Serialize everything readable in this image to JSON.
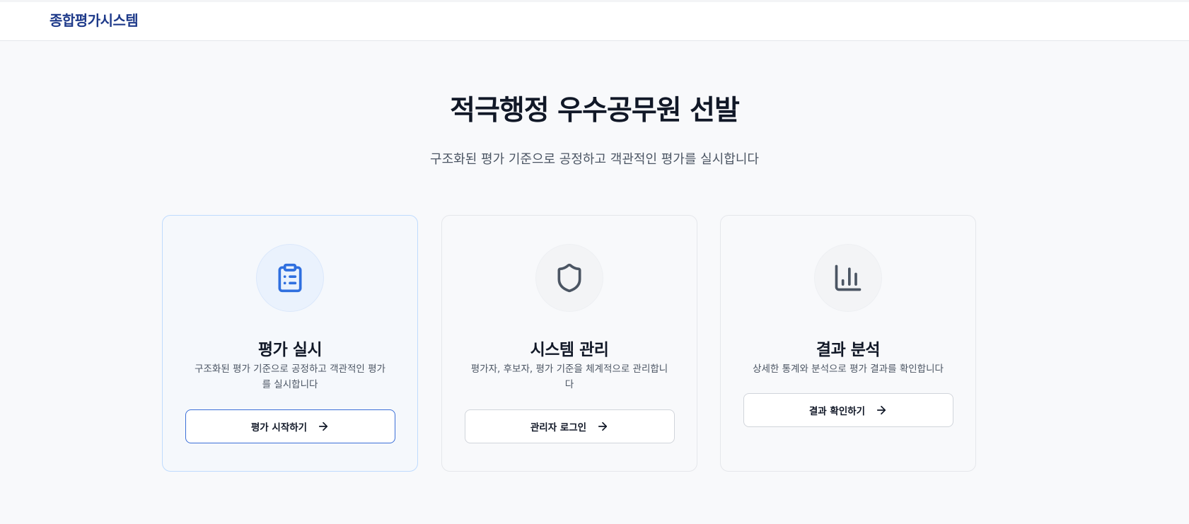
{
  "header": {
    "brand": "종합평가시스템"
  },
  "hero": {
    "title": "적극행정 우수공무원 선발",
    "subtitle": "구조화된 평가 기준으로 공정하고 객관적인 평가를 실시합니다"
  },
  "cards": [
    {
      "icon": "clipboard-list-icon",
      "title": "평가 실시",
      "description": "구조화된 평가 기준으로 공정하고 객관적인 평가를 실시합니다",
      "button": "평가 시작하기"
    },
    {
      "icon": "shield-icon",
      "title": "시스템 관리",
      "description": "평가자, 후보자, 평가 기준을 체계적으로 관리합니다",
      "button": "관리자 로그인"
    },
    {
      "icon": "bar-chart-icon",
      "title": "결과 분석",
      "description": "상세한 통계와 분석으로 평가 결과를 확인합니다",
      "button": "결과 확인하기"
    }
  ],
  "colors": {
    "brand": "#1e3a8a",
    "accent": "#2f6fdf",
    "icon_gray": "#4b5563",
    "background": "#f8f9fb"
  }
}
